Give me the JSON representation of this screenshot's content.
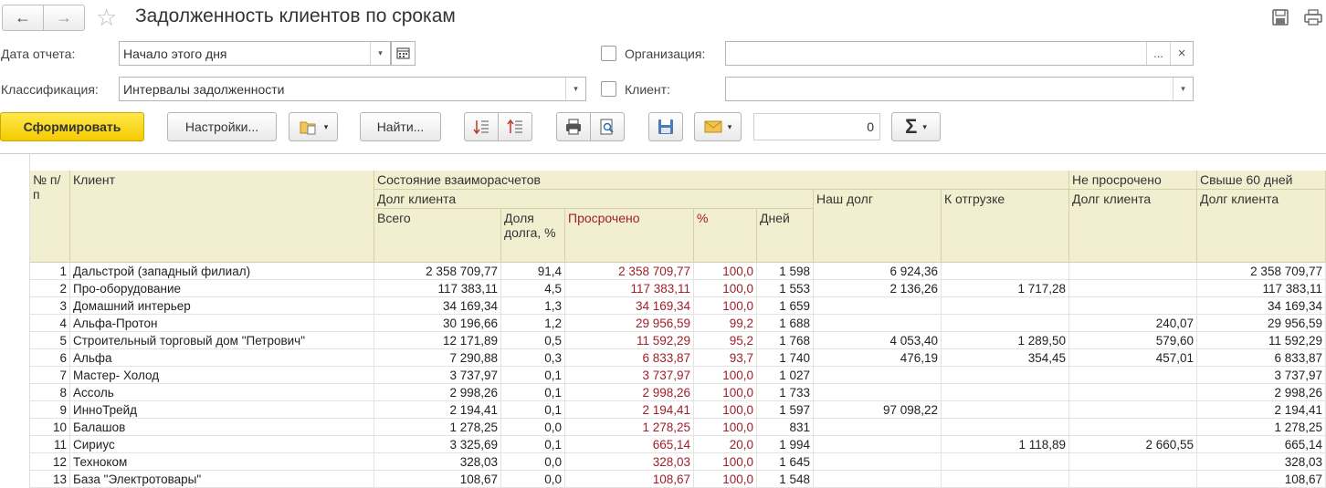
{
  "window": {
    "title": "Задолженность клиентов по срокам",
    "back_icon": "←",
    "forward_icon": "→",
    "favorite_icon": "☆"
  },
  "form": {
    "report_date_label": "Дата отчета:",
    "report_date_value": "Начало этого дня",
    "classification_label": "Классификация:",
    "classification_value": "Интервалы задолженности",
    "organization_label": "Организация:",
    "organization_value": "",
    "organization_checked": false,
    "client_label": "Клиент:",
    "client_value": "",
    "client_checked": false,
    "ellipsis": "...",
    "clear": "×",
    "dropdown": "▾"
  },
  "toolbar": {
    "generate_label": "Сформировать",
    "settings_label": "Настройки...",
    "find_label": "Найти...",
    "number_value": "0",
    "sum_label": "Σ",
    "dropdown": "▾"
  },
  "table": {
    "headers": {
      "num": "№ п/п",
      "client": "Клиент",
      "state": "Состояние взаиморасчетов",
      "client_debt": "Долг клиента",
      "total": "Всего",
      "share": "Доля долга, %",
      "overdue": "Просрочено",
      "pct": "%",
      "days": "Дней",
      "our_debt": "Наш долг",
      "to_ship": "К отгрузке",
      "not_overdue": "Не просрочено",
      "not_overdue_debt": "Долг клиента",
      "over60": "Свыше 60 дней",
      "over60_debt": "Долг клиента"
    },
    "rows": [
      [
        "1",
        "Дальстрой (западный филиал)",
        "2 358 709,77",
        "91,4",
        "2 358 709,77",
        "100,0",
        "1 598",
        "6 924,36",
        "",
        "",
        "2 358 709,77"
      ],
      [
        "2",
        "Про-оборудование",
        "117 383,11",
        "4,5",
        "117 383,11",
        "100,0",
        "1 553",
        "2 136,26",
        "1 717,28",
        "",
        "117 383,11"
      ],
      [
        "3",
        "Домашний интерьер",
        "34 169,34",
        "1,3",
        "34 169,34",
        "100,0",
        "1 659",
        "",
        "",
        "",
        "34 169,34"
      ],
      [
        "4",
        "Альфа-Протон",
        "30 196,66",
        "1,2",
        "29 956,59",
        "99,2",
        "1 688",
        "",
        "",
        "240,07",
        "29 956,59"
      ],
      [
        "5",
        "Строительный торговый дом \"Петрович\"",
        "12 171,89",
        "0,5",
        "11 592,29",
        "95,2",
        "1 768",
        "4 053,40",
        "1 289,50",
        "579,60",
        "11 592,29"
      ],
      [
        "6",
        "Альфа",
        "7 290,88",
        "0,3",
        "6 833,87",
        "93,7",
        "1 740",
        "476,19",
        "354,45",
        "457,01",
        "6 833,87"
      ],
      [
        "7",
        "Мастер- Холод",
        "3 737,97",
        "0,1",
        "3 737,97",
        "100,0",
        "1 027",
        "",
        "",
        "",
        "3 737,97"
      ],
      [
        "8",
        "Ассоль",
        "2 998,26",
        "0,1",
        "2 998,26",
        "100,0",
        "1 733",
        "",
        "",
        "",
        "2 998,26"
      ],
      [
        "9",
        "ИнноТрейд",
        "2 194,41",
        "0,1",
        "2 194,41",
        "100,0",
        "1 597",
        "97 098,22",
        "",
        "",
        "2 194,41"
      ],
      [
        "10",
        "Балашов",
        "1 278,25",
        "0,0",
        "1 278,25",
        "100,0",
        "831",
        "",
        "",
        "",
        "1 278,25"
      ],
      [
        "11",
        "Сириус",
        "3 325,69",
        "0,1",
        "665,14",
        "20,0",
        "1 994",
        "",
        "1 118,89",
        "2 660,55",
        "665,14"
      ],
      [
        "12",
        "Техноком",
        "328,03",
        "0,0",
        "328,03",
        "100,0",
        "1 645",
        "",
        "",
        "",
        "328,03"
      ],
      [
        "13",
        "База \"Электротовары\"",
        "108,67",
        "0,0",
        "108,67",
        "100,0",
        "1 548",
        "",
        "",
        "",
        "108,67"
      ]
    ]
  },
  "colors": {
    "header_bg": "#f2eed0",
    "overdue_text": "#a0202a",
    "primary_button": "#f5cb00"
  }
}
